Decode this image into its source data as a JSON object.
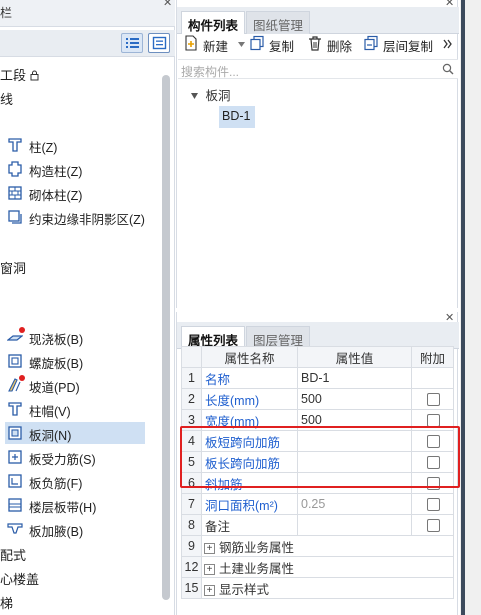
{
  "left": {
    "title_fragment": "栏",
    "items_top": [
      {
        "text": "工段",
        "has_lock": true
      },
      {
        "text": "线"
      }
    ],
    "items_column": [
      {
        "label": "柱(Z)",
        "icon": "column-icon"
      },
      {
        "label": "构造柱(Z)",
        "icon": "constructional-column-icon"
      },
      {
        "label": "砌体柱(Z)",
        "icon": "masonry-column-icon"
      },
      {
        "label": "约束边缘非阴影区(Z)",
        "icon": "boundary-zone-icon"
      }
    ],
    "section_window": "窗洞",
    "items_slab": [
      {
        "label": "现浇板(B)",
        "icon": "cast-slab-icon",
        "dot": true
      },
      {
        "label": "螺旋板(B)",
        "icon": "spiral-slab-icon"
      },
      {
        "label": "坡道(PD)",
        "icon": "ramp-icon",
        "dot": true
      },
      {
        "label": "柱帽(V)",
        "icon": "column-cap-icon"
      },
      {
        "label": "板洞(N)",
        "icon": "slab-hole-icon",
        "selected": true
      },
      {
        "label": "板受力筋(S)",
        "icon": "slab-rebar-icon"
      },
      {
        "label": "板负筋(F)",
        "icon": "slab-negative-rebar-icon"
      },
      {
        "label": "楼层板带(H)",
        "icon": "floor-band-icon"
      },
      {
        "label": "板加腋(B)",
        "icon": "slab-haunch-icon"
      }
    ],
    "items_bottom": [
      "配式",
      "心楼盖",
      "梯"
    ]
  },
  "components": {
    "tabs": [
      "构件列表",
      "图纸管理"
    ],
    "toolbar": {
      "new": "新建",
      "copy": "复制",
      "delete": "删除",
      "floor_copy": "层间复制"
    },
    "search_placeholder": "搜索构件...",
    "tree_root": "板洞",
    "tree_child": "BD-1"
  },
  "properties": {
    "tabs": [
      "属性列表",
      "图层管理"
    ],
    "headers": [
      "属性名称",
      "属性值",
      "附加"
    ],
    "rows": [
      {
        "num": "1",
        "name": "名称",
        "value": "BD-1",
        "name_color": "blue",
        "checkbox": false
      },
      {
        "num": "2",
        "name": "长度(mm)",
        "value": "500",
        "name_color": "blue",
        "checkbox": true
      },
      {
        "num": "3",
        "name": "宽度(mm)",
        "value": "500",
        "name_color": "blue",
        "checkbox": true
      },
      {
        "num": "4",
        "name": "板短跨向加筋",
        "value": "",
        "name_color": "blue",
        "checkbox": true
      },
      {
        "num": "5",
        "name": "板长跨向加筋",
        "value": "",
        "name_color": "blue",
        "checkbox": true
      },
      {
        "num": "6",
        "name": "斜加筋",
        "value": "",
        "name_color": "blue",
        "checkbox": true
      },
      {
        "num": "7",
        "name": "洞口面积(m²)",
        "value": "0.25",
        "name_color": "blue",
        "value_color": "gray",
        "checkbox": true
      },
      {
        "num": "8",
        "name": "备注",
        "value": "",
        "name_color": "black",
        "checkbox": true
      },
      {
        "num": "9",
        "name": "钢筋业务属性",
        "value": "",
        "expandable": true
      },
      {
        "num": "12",
        "name": "土建业务属性",
        "value": "",
        "expandable": true
      },
      {
        "num": "15",
        "name": "显示样式",
        "value": "",
        "expandable": true
      }
    ]
  },
  "highlight_color": "#e02020",
  "accent_color": "#1f5fcf"
}
